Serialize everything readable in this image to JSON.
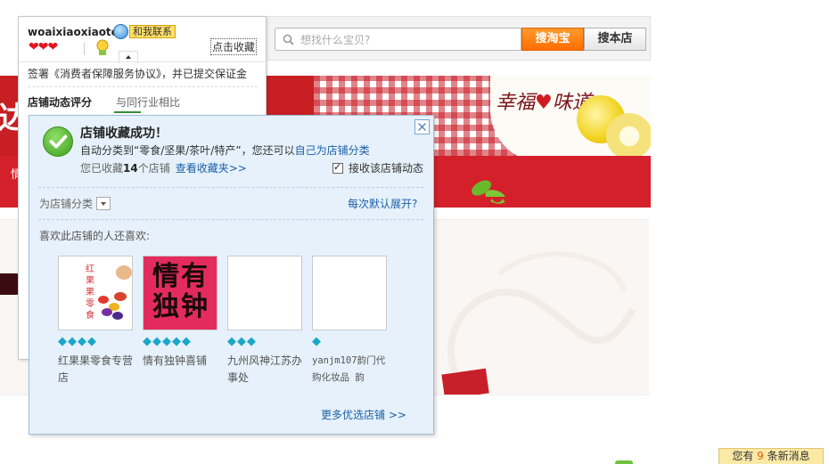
{
  "search": {
    "placeholder": "想找什么宝贝?",
    "search_taobao_label": "搜淘宝",
    "search_store_label": "搜本店"
  },
  "banner": {
    "big_text": "达",
    "logo_text_a": "幸福",
    "logo_heart": "♥",
    "logo_text_b": "味道",
    "stripe_char": "情"
  },
  "shop_card": {
    "shop_name": "woaixiaoxiaote",
    "contact_label": "和我联系",
    "hearts": "❤❤❤",
    "favorite_link": "点击收藏",
    "guarantee_text": "签署《消费者保障服务协议》，并已提交保证金",
    "tab_dynamic_score": "店铺动态评分",
    "tab_industry_compare": "与同行业相比"
  },
  "popup": {
    "title": "店铺收藏成功！",
    "desc_prefix": "自动分类到“零食/坚果/茶叶/特产”，您还可以",
    "desc_link": "自己为店铺分类",
    "count_prefix": "您已收藏",
    "count_value": "14",
    "count_suffix": "个店铺",
    "view_favorites_link": "查看收藏夹>>",
    "receive_updates_label": "接收该店铺动态",
    "receive_updates_checked": true,
    "category_label": "为店铺分类",
    "expand_default_link": "每次默认展开?",
    "liked_label": "喜欢此店铺的人还喜欢:",
    "more_shops_link": "更多优选店铺 >>",
    "shops": [
      {
        "name": "红果果零食专营店",
        "diamonds": 4,
        "diamond_glyphs": "💎💎💎💎"
      },
      {
        "name": "情有独钟喜铺",
        "diamonds": 5,
        "diamond_glyphs": "💎💎💎💎💎",
        "thumb_text": "情有独钟"
      },
      {
        "name": "九州风神江苏办事处",
        "diamonds": 3,
        "diamond_glyphs": "💎💎💎"
      },
      {
        "name": "yanjm107韵门代购化妆品 韵",
        "diamonds": 1,
        "diamond_glyphs": "💎"
      }
    ],
    "candy_thumb_text": "红果果零食"
  },
  "message_bar": {
    "prefix": "您有",
    "count": "9",
    "suffix": "条新消息"
  },
  "colors": {
    "accent_orange": "#ff7a00",
    "brand_red": "#c71f23",
    "link_blue": "#1b5fa8",
    "diamond_cyan": "#1aa7c9"
  }
}
